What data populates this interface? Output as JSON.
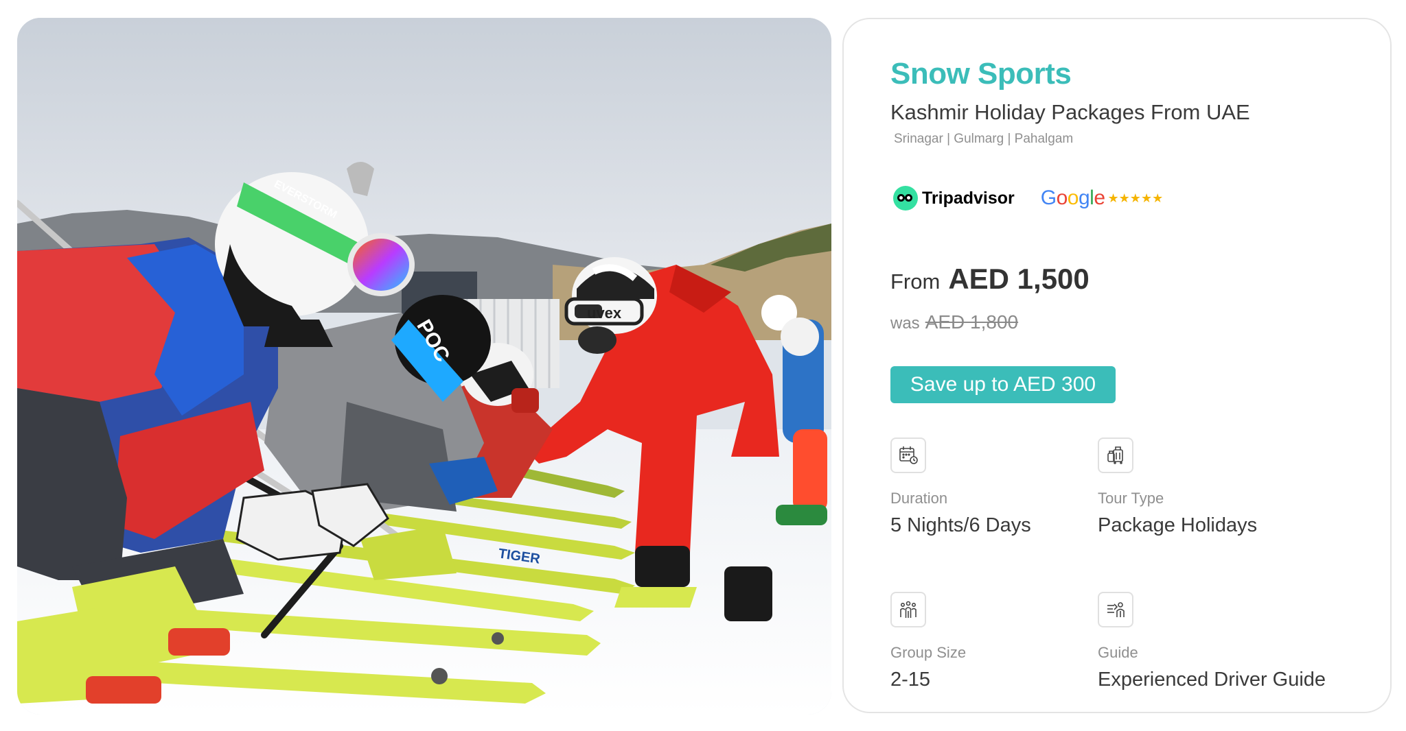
{
  "photo": {
    "helmet_brands": [
      "POC",
      "uvex"
    ],
    "ski_brand": "TIGER",
    "goggle_strap": "EVERSTORM"
  },
  "card": {
    "title": "Snow Sports",
    "subtitle": "Kashmir Holiday Packages From UAE",
    "locations": "Srinagar | Gulmarg | Pahalgam",
    "reviews": {
      "tripadvisor": "Tripadvisor",
      "google_letters": [
        "G",
        "o",
        "o",
        "g",
        "l",
        "e"
      ],
      "google_colors": [
        "#4285F4",
        "#EA4335",
        "#FBBC05",
        "#4285F4",
        "#34A853",
        "#EA4335"
      ],
      "google_stars": "★★★★★",
      "google_rating": 5
    },
    "price": {
      "from_label": "From",
      "amount": "AED 1,500",
      "was_label": "was",
      "was_amount": "AED 1,800"
    },
    "save_button": "Save up to AED 300",
    "features": [
      {
        "icon": "calendar-clock-icon",
        "label": "Duration",
        "value": "5 Nights/6 Days"
      },
      {
        "icon": "luggage-icon",
        "label": "Tour Type",
        "value": "Package Holidays"
      },
      {
        "icon": "group-people-icon",
        "label": "Group Size",
        "value": "2-15"
      },
      {
        "icon": "driver-guide-icon",
        "label": "Guide",
        "value": "Experienced Driver Guide"
      }
    ]
  },
  "colors": {
    "accent": "#3bbdb9",
    "text": "#3a3a3a",
    "muted": "#8f8f8f",
    "star": "#f5b400"
  }
}
